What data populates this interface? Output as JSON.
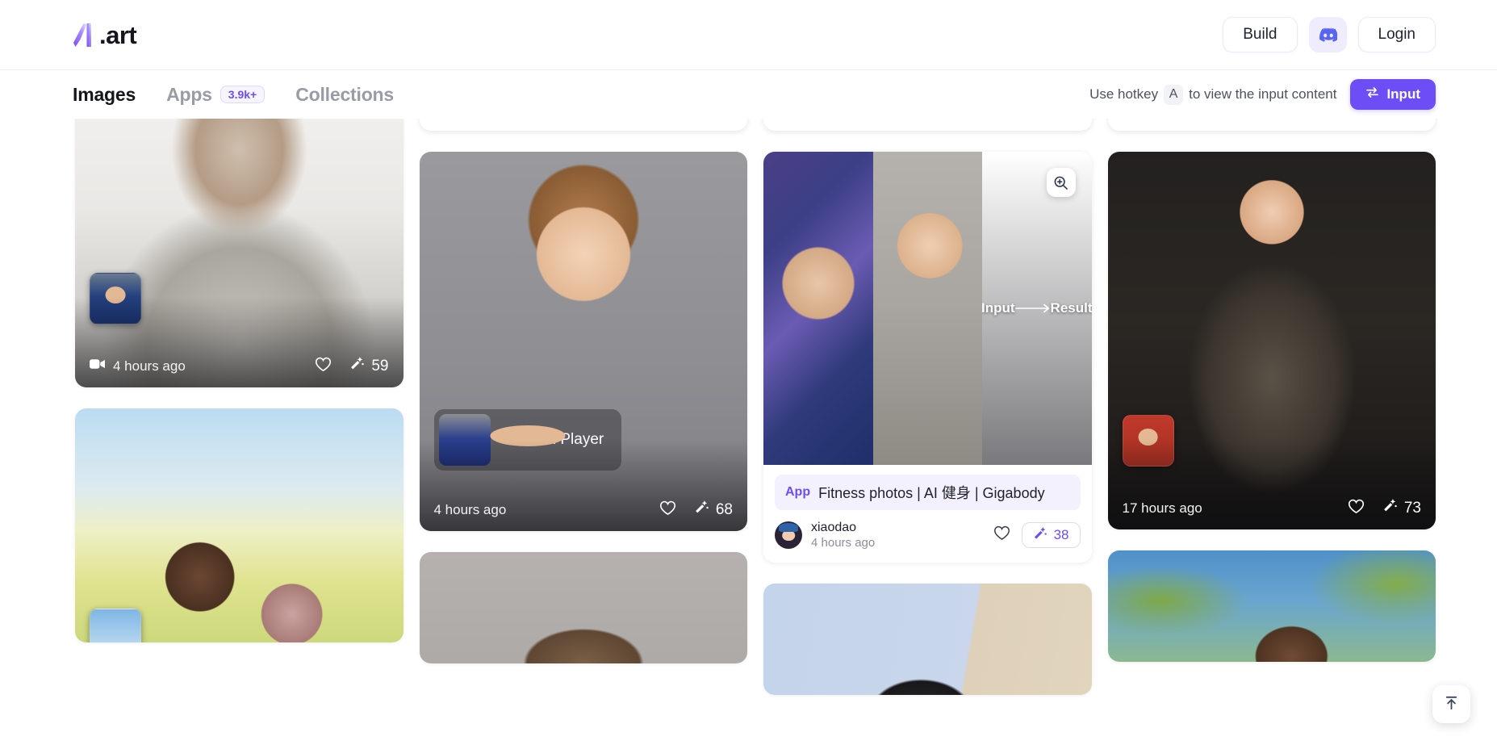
{
  "header": {
    "logo_text": ".art",
    "logo_icon": "a-art-logo-icon",
    "build_label": "Build",
    "discord_icon": "discord-icon",
    "login_label": "Login"
  },
  "subnav": {
    "tabs": [
      {
        "label": "Images",
        "active": true,
        "badge": null
      },
      {
        "label": "Apps",
        "active": false,
        "badge": "3.9k+"
      },
      {
        "label": "Collections",
        "active": false,
        "badge": null
      }
    ],
    "hotkey_prefix": "Use hotkey",
    "hotkey_key": "A",
    "hotkey_suffix": "to view the input content",
    "input_button_label": "Input",
    "input_button_icon": "swap-arrows-icon"
  },
  "accent_color": "#6d4df6",
  "cards": [
    {
      "id": "card-man-sweater",
      "type": "image-overlay",
      "media_icon": "video-icon",
      "time": "4 hours ago",
      "like_icon": "heart-icon",
      "generation_icon": "magic-wand-icon",
      "generation_count": "59",
      "mini_thumb_label": null
    },
    {
      "id": "card-cartoon-footballer",
      "type": "image-overlay",
      "media_icon": null,
      "time": "4 hours ago",
      "like_icon": "heart-icon",
      "generation_icon": "magic-wand-icon",
      "generation_count": "68",
      "mini_thumb_label": "Football Player"
    },
    {
      "id": "card-fitness-app",
      "type": "app-card",
      "zoom_icon": "zoom-in-icon",
      "compare_left_label": "Input",
      "compare_arrow_icon": "arrow-right-icon",
      "compare_right_label": "Result",
      "app_tag": "App",
      "app_name": "Fitness photos | AI 健身 |  Gigabody",
      "user_name": "xiaodao",
      "time": "4 hours ago",
      "like_icon": "heart-icon",
      "generation_icon": "magic-wand-icon",
      "generation_count": "38"
    },
    {
      "id": "card-warrior-woman",
      "type": "image-overlay",
      "media_icon": null,
      "time": "17 hours ago",
      "like_icon": "heart-icon",
      "generation_icon": "magic-wand-icon",
      "generation_count": "73",
      "mini_thumb_label": null
    }
  ],
  "scroll_top": {
    "icon": "scroll-to-top-icon"
  }
}
